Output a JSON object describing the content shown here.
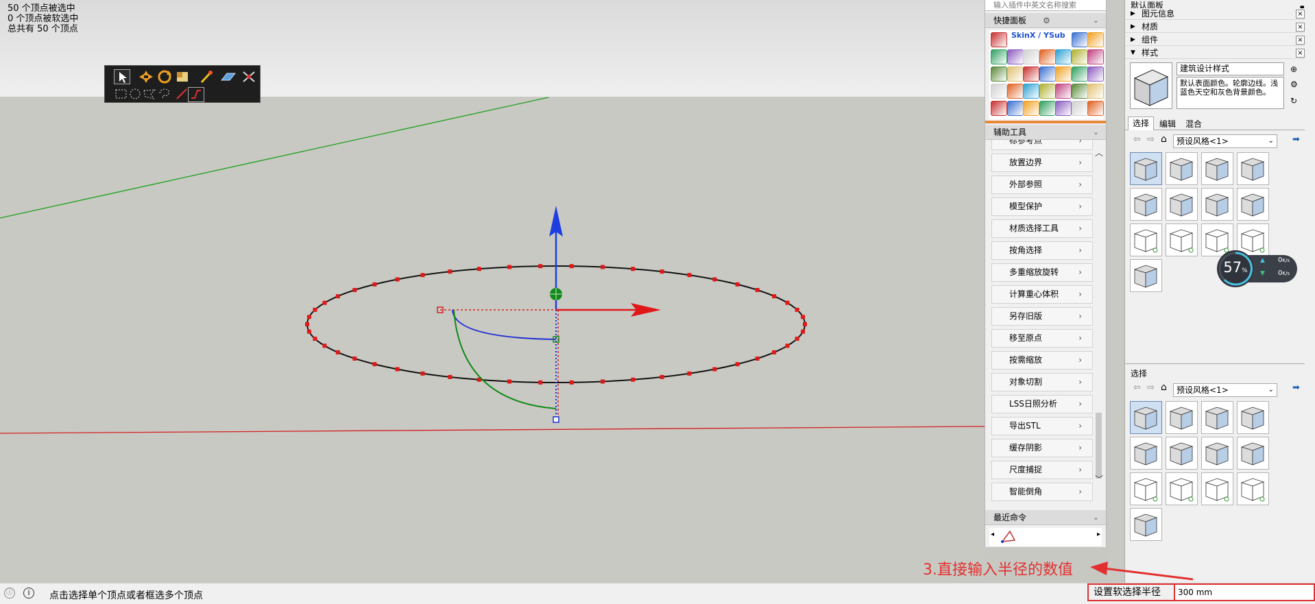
{
  "viewport": {
    "selection_info": [
      "50 个顶点被选中",
      "0 个顶点被软选中",
      "总共有 50 个顶点"
    ]
  },
  "plugin_panel": {
    "search_placeholder": "输入插件中英文名称搜索",
    "quick_panel_title": "快捷面板",
    "skin_label": "SkinX / YSub",
    "aux_tools_title": "辅助工具",
    "aux_tools": [
      "标参考点",
      "放置边界",
      "外部参照",
      "模型保护",
      "材质选择工具",
      "按角选择",
      "多重缩放旋转",
      "计算重心体积",
      "另存旧版",
      "移至原点",
      "按需缩放",
      "对象切割",
      "LSS日照分析",
      "导出STL",
      "缓存阴影",
      "尺度捕捉",
      "智能倒角"
    ],
    "recent_title": "最近命令"
  },
  "right_panel": {
    "tray_title": "默认面板",
    "sections": [
      "图元信息",
      "材质",
      "组件",
      "样式"
    ],
    "style_name": "建筑设计样式",
    "style_desc": "默认表面颜色。轮廓边线。浅蓝色天空和灰色背景颜色。",
    "tabs": [
      "选择",
      "编辑",
      "混合"
    ],
    "dropdown_value": "预设风格<1>",
    "lower_title": "选择",
    "lower_dropdown_value": "预设风格<1>"
  },
  "speed_widget": {
    "percent": "57",
    "percent_sign": "%",
    "up": "0",
    "down": "0",
    "unit": "K/s"
  },
  "status_bar": {
    "message": "点击选择单个顶点或者框选多个顶点",
    "vcb_label": "设置软选择半径",
    "vcb_value": "300 mm"
  },
  "annotation": "3.直接输入半径的数值"
}
